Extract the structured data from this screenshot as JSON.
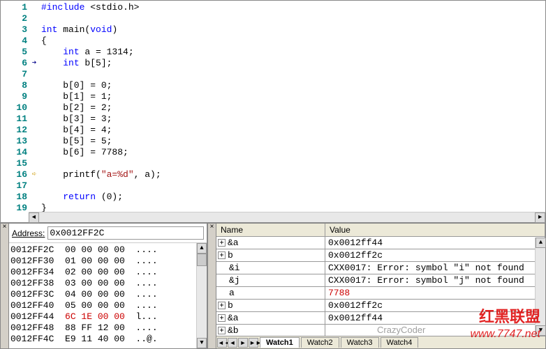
{
  "code": {
    "lines": [
      {
        "n": "1",
        "marker": "",
        "html": "<span class='pp'>#include</span> &lt;stdio.h&gt;"
      },
      {
        "n": "2",
        "marker": "",
        "html": ""
      },
      {
        "n": "3",
        "marker": "",
        "html": "<span class='kw'>int</span> main(<span class='kw'>void</span>)"
      },
      {
        "n": "4",
        "marker": "",
        "html": "{"
      },
      {
        "n": "5",
        "marker": "",
        "html": "    <span class='kw'>int</span> a = 1314;"
      },
      {
        "n": "6",
        "marker": "bp",
        "html": "    <span class='kw'>int</span> b[5];"
      },
      {
        "n": "7",
        "marker": "",
        "html": ""
      },
      {
        "n": "8",
        "marker": "",
        "html": "    b[0] = 0;"
      },
      {
        "n": "9",
        "marker": "",
        "html": "    b[1] = 1;"
      },
      {
        "n": "10",
        "marker": "",
        "html": "    b[2] = 2;"
      },
      {
        "n": "11",
        "marker": "",
        "html": "    b[3] = 3;"
      },
      {
        "n": "12",
        "marker": "",
        "html": "    b[4] = 4;"
      },
      {
        "n": "13",
        "marker": "",
        "html": "    b[5] = 5;"
      },
      {
        "n": "14",
        "marker": "",
        "html": "    b[6] = 7788;"
      },
      {
        "n": "15",
        "marker": "",
        "html": ""
      },
      {
        "n": "16",
        "marker": "cur",
        "html": "    printf(<span class='str'>\"a=%d\"</span>, a);"
      },
      {
        "n": "17",
        "marker": "",
        "html": ""
      },
      {
        "n": "18",
        "marker": "",
        "html": "    <span class='kw'>return</span> (0);"
      },
      {
        "n": "19",
        "marker": "",
        "html": "}"
      }
    ]
  },
  "memory": {
    "address_label": "Address:",
    "address_value": "0x0012FF2C",
    "rows": [
      {
        "addr": "0012FF2C",
        "hex": "00 00 00 00",
        "ascii": "....",
        "hl": false
      },
      {
        "addr": "0012FF30",
        "hex": "01 00 00 00",
        "ascii": "....",
        "hl": false
      },
      {
        "addr": "0012FF34",
        "hex": "02 00 00 00",
        "ascii": "....",
        "hl": false
      },
      {
        "addr": "0012FF38",
        "hex": "03 00 00 00",
        "ascii": "....",
        "hl": false
      },
      {
        "addr": "0012FF3C",
        "hex": "04 00 00 00",
        "ascii": "....",
        "hl": false
      },
      {
        "addr": "0012FF40",
        "hex": "05 00 00 00",
        "ascii": "....",
        "hl": false
      },
      {
        "addr": "0012FF44",
        "hex": "6C 1E 00 00",
        "ascii": "l...",
        "hl": true
      },
      {
        "addr": "0012FF48",
        "hex": "88 FF 12 00",
        "ascii": "....",
        "hl": false
      },
      {
        "addr": "0012FF4C",
        "hex": "E9 11 40 00",
        "ascii": "..@.",
        "hl": false
      }
    ]
  },
  "watch": {
    "header_name": "Name",
    "header_value": "Value",
    "rows": [
      {
        "exp": true,
        "name": "&a",
        "value": "0x0012ff44",
        "red": false
      },
      {
        "exp": true,
        "name": "b",
        "value": "0x0012ff2c",
        "red": false
      },
      {
        "exp": false,
        "indent": true,
        "name": "&i",
        "value": "CXX0017: Error: symbol \"i\" not found",
        "red": false
      },
      {
        "exp": false,
        "indent": true,
        "name": "&j",
        "value": "CXX0017: Error: symbol \"j\" not found",
        "red": false
      },
      {
        "exp": false,
        "indent": true,
        "name": "a",
        "value": "7788",
        "red": true
      },
      {
        "exp": true,
        "name": "b",
        "value": "0x0012ff2c",
        "red": false
      },
      {
        "exp": true,
        "name": "&a",
        "value": "0x0012ff44",
        "red": false
      },
      {
        "exp": true,
        "name": "&b",
        "value": "",
        "red": false
      }
    ],
    "tabs": [
      "Watch1",
      "Watch2",
      "Watch3",
      "Watch4"
    ],
    "active_tab": 0
  },
  "watermark": {
    "text1": "红黑联盟",
    "text2": "www.7747.net",
    "crazy": "CrazyCoder"
  }
}
